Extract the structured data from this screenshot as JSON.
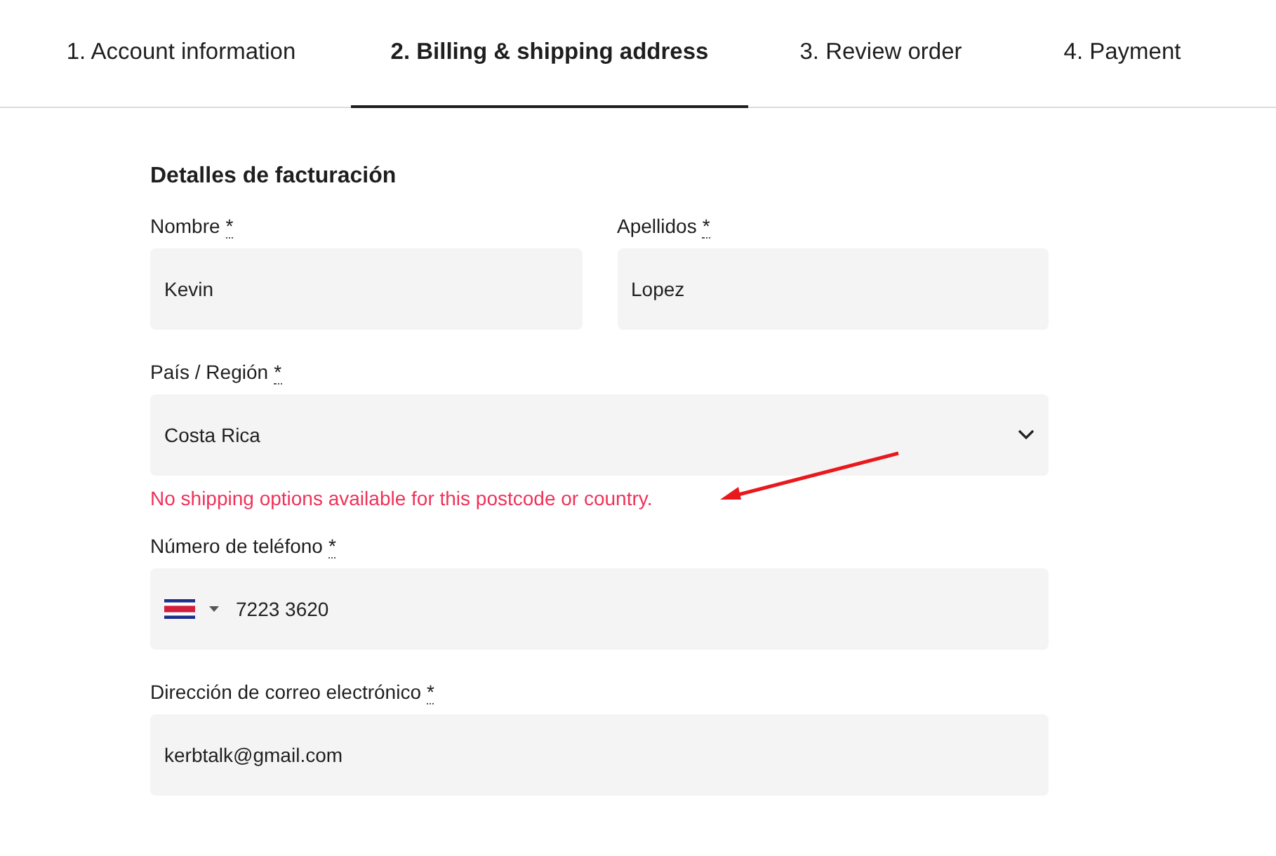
{
  "tabs": [
    {
      "label": "1. Account information",
      "selected": false
    },
    {
      "label": "2. Billing & shipping address",
      "selected": true
    },
    {
      "label": "3. Review order",
      "selected": false
    },
    {
      "label": "4. Payment",
      "selected": false
    }
  ],
  "form": {
    "heading": "Detalles de facturación",
    "rows": [
      {
        "fields": [
          {
            "kind": "text",
            "label": "Nombre",
            "required": "*",
            "value": "Kevin"
          },
          {
            "kind": "text",
            "label": "Apellidos",
            "required": "*",
            "value": "Lopez"
          }
        ]
      },
      {
        "fields": [
          {
            "kind": "select",
            "label": "País / Región",
            "required": "*",
            "value": "Costa Rica",
            "error": "No shipping options available for this postcode or country."
          }
        ]
      },
      {
        "fields": [
          {
            "kind": "phone",
            "label": "Número de teléfono",
            "required": "*",
            "value": "7223 3620"
          }
        ]
      },
      {
        "fields": [
          {
            "kind": "text",
            "label": "Dirección de correo electrónico",
            "required": "*",
            "value": "kerbtalk@gmail.com"
          }
        ]
      }
    ]
  }
}
